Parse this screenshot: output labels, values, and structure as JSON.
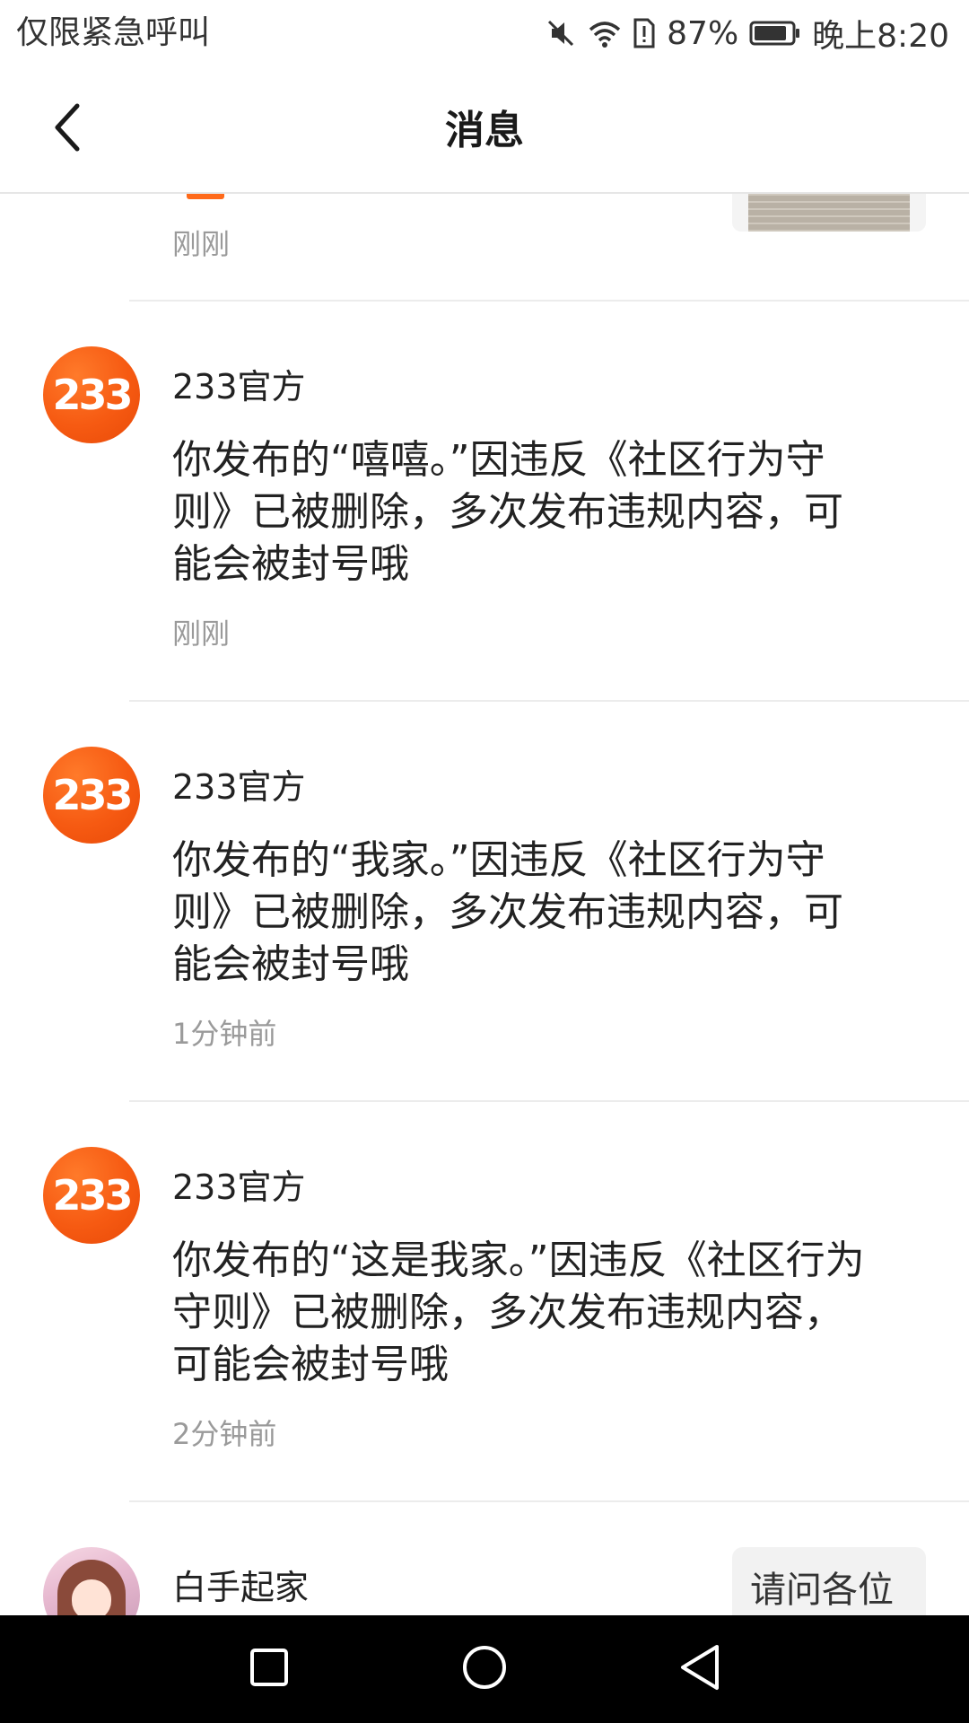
{
  "status_bar": {
    "carrier_text": "仅限紧急呼叫",
    "battery_percent": "87%",
    "time": "晚上8:20",
    "battery_level": 0.87
  },
  "header": {
    "title": "消息"
  },
  "partial_item": {
    "time": "刚刚"
  },
  "messages": [
    {
      "avatar_text": "233",
      "sender": "233官方",
      "body": "你发布的“嘻嘻。”因违反《社区行为守则》已被删除，多次发布违规内容，可能会被封号哦",
      "time": "刚刚"
    },
    {
      "avatar_text": "233",
      "sender": "233官方",
      "body": "你发布的“我家。”因违反《社区行为守则》已被删除，多次发布违规内容，可能会被封号哦",
      "time": "1分钟前"
    },
    {
      "avatar_text": "233",
      "sender": "233官方",
      "body": "你发布的“这是我家。”因违反《社区行为守则》已被删除，多次发布违规内容，可能会被封号哦",
      "time": "2分钟前"
    }
  ],
  "last_item": {
    "sender": "白手起家",
    "preview": "请问各位"
  },
  "colors": {
    "accent": "#f65a12",
    "nav_bar": "#000000",
    "time_gray": "#9a9a9a"
  },
  "icons": {
    "back": "chevron-left-icon",
    "mute": "mute-icon",
    "wifi": "wifi-icon",
    "sim": "sim-alert-icon",
    "battery": "battery-icon",
    "nav_recent": "square-icon",
    "nav_home": "circle-icon",
    "nav_back": "triangle-back-icon"
  }
}
